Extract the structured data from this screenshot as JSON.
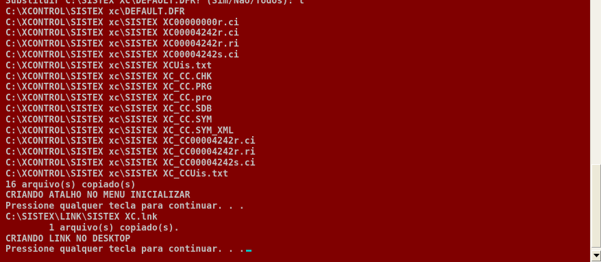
{
  "console": {
    "colors": {
      "background": "#800000",
      "text": "#c0c0c0",
      "cursor": "#00c0c0"
    },
    "lines": [
      "Substituir C:\\SISTEX XC\\DEFAULT.DFR? (Sim/Não/Todos): t",
      "C:\\XCONTROL\\SISTEX xc\\DEFAULT.DFR",
      "C:\\XCONTROL\\SISTEX xc\\SISTEX XC00000000r.ci",
      "C:\\XCONTROL\\SISTEX xc\\SISTEX XC00004242r.ci",
      "C:\\XCONTROL\\SISTEX xc\\SISTEX XC00004242r.ri",
      "C:\\XCONTROL\\SISTEX xc\\SISTEX XC00004242s.ci",
      "C:\\XCONTROL\\SISTEX xc\\SISTEX XCUis.txt",
      "C:\\XCONTROL\\SISTEX xc\\SISTEX XC_CC.CHK",
      "C:\\XCONTROL\\SISTEX xc\\SISTEX XC_CC.PRG",
      "C:\\XCONTROL\\SISTEX xc\\SISTEX XC_CC.pro",
      "C:\\XCONTROL\\SISTEX xc\\SISTEX XC_CC.SDB",
      "C:\\XCONTROL\\SISTEX xc\\SISTEX XC_CC.SYM",
      "C:\\XCONTROL\\SISTEX xc\\SISTEX XC_CC.SYM_XML",
      "C:\\XCONTROL\\SISTEX xc\\SISTEX XC_CC00004242r.ci",
      "C:\\XCONTROL\\SISTEX xc\\SISTEX XC_CC00004242r.ri",
      "C:\\XCONTROL\\SISTEX xc\\SISTEX XC_CC00004242s.ci",
      "C:\\XCONTROL\\SISTEX xc\\SISTEX XC_CCUis.txt",
      "16 arquivo(s) copiado(s)",
      "CRIANDO ATALHO NO MENU INICIALIZAR",
      "Pressione qualquer tecla para continuar. . .",
      "C:\\SISTEX\\LINK\\SISTEX XC.lnk",
      "        1 arquivo(s) copiado(s).",
      "CRIANDO LINK NO DESKTOP",
      "Pressione qualquer tecla para continuar. . ."
    ]
  },
  "scrollbar": {
    "down_arrow_icon": "chevron-down-icon"
  }
}
